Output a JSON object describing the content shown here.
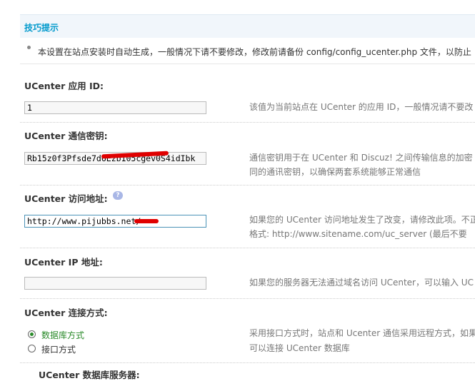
{
  "tips": {
    "title": "技巧提示",
    "text": "本设置在站点安装时自动生成，一般情况下请不要修改，修改前请备份 config/config_ucenter.php 文件，以防止"
  },
  "fields": {
    "app_id": {
      "label": "UCenter 应用 ID:",
      "value": "1",
      "help1": "该值为当前站点在 UCenter 的应用 ID，一般情况请不要改"
    },
    "key": {
      "label": "UCenter 通信密钥:",
      "value": "Rb15z0f3Pfsde7d6Ezb105cgev0S4idIbk",
      "help1": "通信密钥用于在 UCenter 和 Discuz! 之间传输信息的加密",
      "help2": "同的通讯密钥，以确保两套系统能够正常通信"
    },
    "url": {
      "label": "UCenter 访问地址:",
      "value": "http://www.pijubbs.net/",
      "help1": "如果您的 UCenter 访问地址发生了改变，请修改此项。不正",
      "help2": "格式: http://www.sitename.com/uc_server (最后不要"
    },
    "ip": {
      "label": "UCenter IP 地址:",
      "value": "",
      "help1": "如果您的服务器无法通过域名访问 UCenter，可以输入 UC"
    },
    "connect": {
      "label": "UCenter 连接方式:",
      "options": [
        "数据库方式",
        "接口方式"
      ],
      "selected": "数据库方式",
      "help1": "采用接口方式时，站点和 Ucenter 通信采用远程方式，如果",
      "help2": "可以连接 UCenter 数据库"
    },
    "db_server": {
      "label": "UCenter 数据库服务器:"
    }
  },
  "colors": {
    "accent": "#0099cc",
    "selected_option": "#2a8a2a",
    "redaction": "#e00000"
  }
}
